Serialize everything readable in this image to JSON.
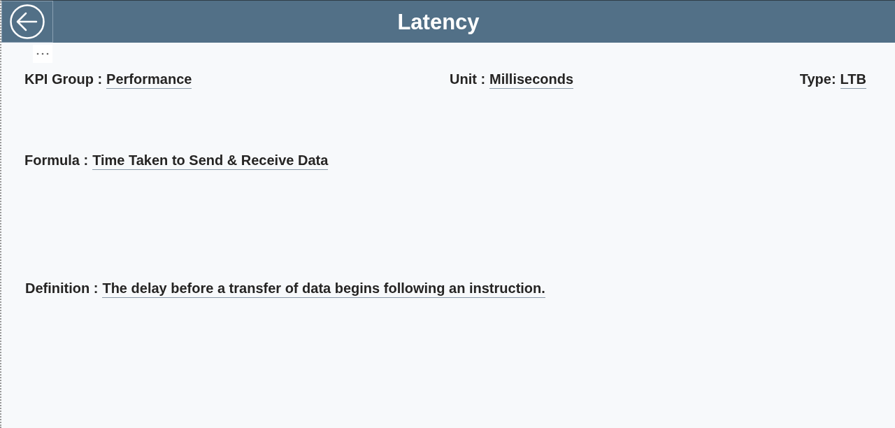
{
  "header": {
    "title": "Latency"
  },
  "rows": [
    {
      "fields": [
        {
          "label": "KPI Group :",
          "value": "Performance"
        },
        {
          "label": "Unit :",
          "value": "Milliseconds"
        },
        {
          "label": "Type:",
          "value": "LTB"
        }
      ]
    },
    {
      "fields": [
        {
          "label": "Formula :",
          "value": "Time Taken to Send & Receive Data"
        }
      ]
    },
    {
      "fields": [
        {
          "label": "Definition :",
          "value": "The delay before a transfer of data begins following an instruction."
        }
      ]
    }
  ]
}
